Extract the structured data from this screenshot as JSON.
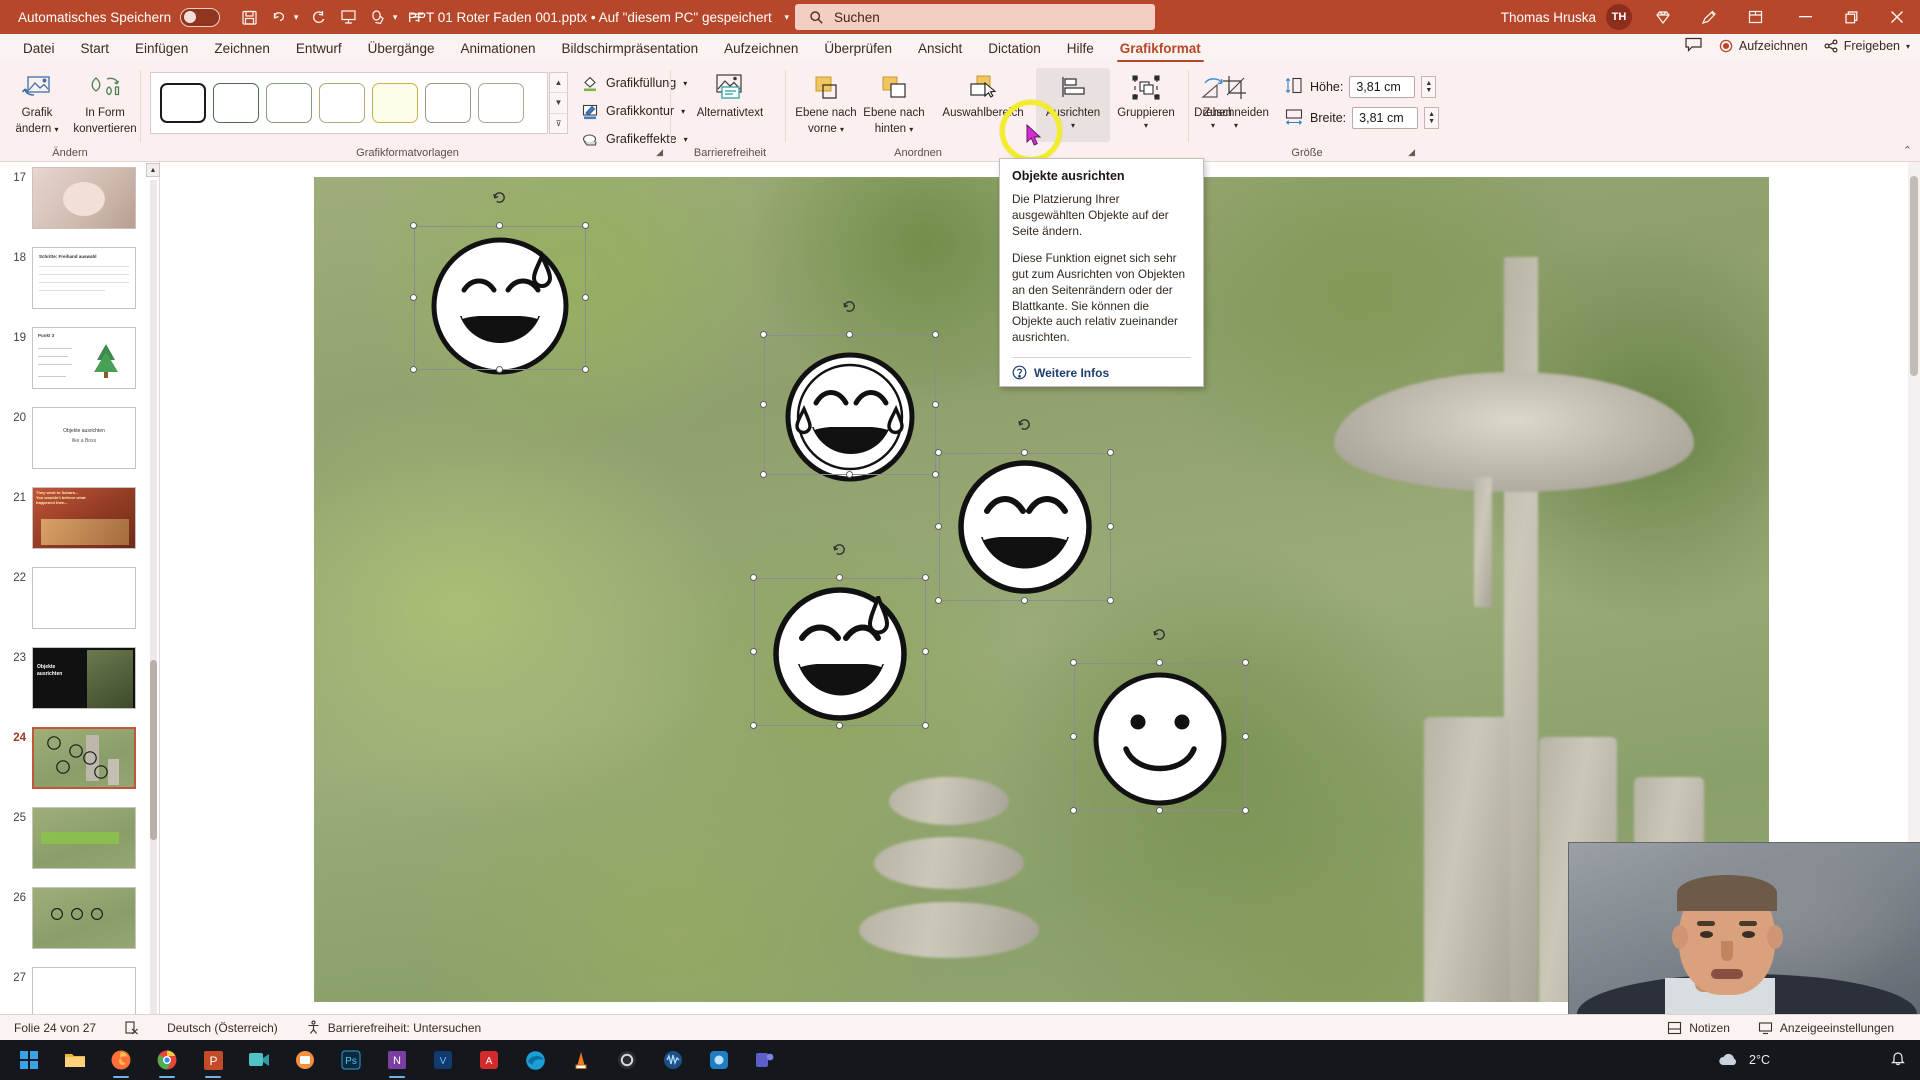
{
  "titlebar": {
    "autosave_label": "Automatisches Speichern",
    "autosave_state": "off",
    "quick_access": [
      "save-icon",
      "undo-icon",
      "redo-icon",
      "present-icon",
      "touch-mode-icon",
      "customize-qat-icon"
    ],
    "document_title": "PPT 01 Roter Faden 001.pptx  •  Auf \"diesem PC\" gespeichert",
    "search_placeholder": "Suchen",
    "user_name": "Thomas Hruska",
    "user_initials": "TH",
    "right_icons": [
      "diamond-icon",
      "pen-icon",
      "ribbon-display-options-icon"
    ],
    "window_buttons": [
      "minimize",
      "restore",
      "close"
    ],
    "accent_color": "#b7472a"
  },
  "tabs": [
    {
      "label": "Datei",
      "active": false
    },
    {
      "label": "Start",
      "active": false
    },
    {
      "label": "Einfügen",
      "active": false
    },
    {
      "label": "Zeichnen",
      "active": false
    },
    {
      "label": "Entwurf",
      "active": false
    },
    {
      "label": "Übergänge",
      "active": false
    },
    {
      "label": "Animationen",
      "active": false
    },
    {
      "label": "Bildschirmpräsentation",
      "active": false
    },
    {
      "label": "Aufzeichnen",
      "active": false
    },
    {
      "label": "Überprüfen",
      "active": false
    },
    {
      "label": "Ansicht",
      "active": false
    },
    {
      "label": "Dictation",
      "active": false
    },
    {
      "label": "Hilfe",
      "active": false
    },
    {
      "label": "Grafikformat",
      "active": true
    }
  ],
  "ribbon": {
    "groups": [
      {
        "name": "Ändern",
        "title": "Ändern"
      },
      {
        "name": "Grafikformatvorlagen",
        "title": "Grafikformatvorlagen"
      },
      {
        "name": "Barrierefreiheit",
        "title": "Barrierefreiheit"
      },
      {
        "name": "Anordnen",
        "title": "Anordnen"
      },
      {
        "name": "Größe",
        "title": "Größe"
      }
    ],
    "aendern": {
      "grafik_aendern": "Grafik\nändern",
      "grafik_aendern_l1": "Grafik",
      "grafik_aendern_l2": "ändern",
      "in_form_l1": "In Form",
      "in_form_l2": "konvertieren"
    },
    "styles": {
      "fill_label": "Grafikfüllung",
      "outline_label": "Grafikkontur",
      "effects_label": "Grafikeffekte"
    },
    "accessibility": {
      "alt_text": "Alternativtext"
    },
    "arrange": {
      "bring_forward_l1": "Ebene nach",
      "bring_forward_l2": "vorne",
      "send_backward_l1": "Ebene nach",
      "send_backward_l2": "hinten",
      "selection_pane": "Auswahlbereich",
      "align": "Ausrichten",
      "group": "Gruppieren",
      "rotate": "Drehen"
    },
    "size": {
      "crop": "Zuschneiden",
      "height_label": "Höhe:",
      "height_value": "3,81 cm",
      "width_label": "Breite:",
      "width_value": "3,81 cm"
    }
  },
  "tooltip": {
    "title": "Objekte ausrichten",
    "body1": "Die Platzierung Ihrer ausgewählten Objekte auf der Seite ändern.",
    "body2": "Diese Funktion eignet sich sehr gut zum Ausrichten von Objekten an den Seitenrändern oder der Blattkante. Sie können die Objekte auch relativ zueinander ausrichten.",
    "more_info": "Weitere Infos"
  },
  "thumbnails": [
    {
      "number": "17",
      "kind": "photo-slide",
      "selected": false
    },
    {
      "number": "18",
      "kind": "text-slide",
      "selected": false
    },
    {
      "number": "19",
      "kind": "tree-slide",
      "selected": false
    },
    {
      "number": "20",
      "kind": "text-slide",
      "selected": false
    },
    {
      "number": "21",
      "kind": "red-image-slide",
      "selected": false
    },
    {
      "number": "22",
      "kind": "blank",
      "selected": false
    },
    {
      "number": "23",
      "kind": "dark-title-slide",
      "selected": false
    },
    {
      "number": "24",
      "kind": "smiley-photo-slide",
      "selected": true
    },
    {
      "number": "25",
      "kind": "photo-green-slide",
      "selected": false
    },
    {
      "number": "26",
      "kind": "photo-slide",
      "selected": false
    },
    {
      "number": "27",
      "kind": "blank",
      "selected": false
    }
  ],
  "thumb_texts": {
    "t20_line1": "Objekte ausrichten",
    "t20_line2": "like a Boss",
    "t21_line1": "They went to Sahara...",
    "t21_line2": "You wouldn't believe what",
    "t21_line3": "happened then...",
    "t23_line1": "Objekte",
    "t23_line2": "ausrichten",
    "t19_title": "Punkt 3"
  },
  "slide": {
    "background": "blurred-garden-photo",
    "objects": [
      {
        "name": "smiley-sweat-grin",
        "selected": true
      },
      {
        "name": "smiley-laughing-tears",
        "selected": true
      },
      {
        "name": "smiley-grin-closed-eyes",
        "selected": true
      },
      {
        "name": "smiley-sweat-smile",
        "selected": true
      },
      {
        "name": "smiley-neutral-smile",
        "selected": true
      }
    ]
  },
  "statusbar": {
    "slide_counter": "Folie 24 von 27",
    "language": "Deutsch (Österreich)",
    "accessibility": "Barrierefreiheit: Untersuchen",
    "notes": "Notizen",
    "display_settings": "Anzeigeeinstellungen"
  },
  "taskbar": {
    "start": "start-icon",
    "items": [
      "file-explorer-icon",
      "firefox-icon",
      "chrome-icon",
      "powerpoint-icon",
      "camtasia-icon",
      "snagit-icon",
      "photoshop-icon",
      "onenote-icon",
      "vegas-icon",
      "acrobat-icon",
      "edge-icon",
      "vlc-icon",
      "obs-icon",
      "audacity-icon",
      "blue-icon",
      "teams-icon"
    ],
    "temperature": "2°C",
    "weather_icon": "cloud-icon"
  }
}
